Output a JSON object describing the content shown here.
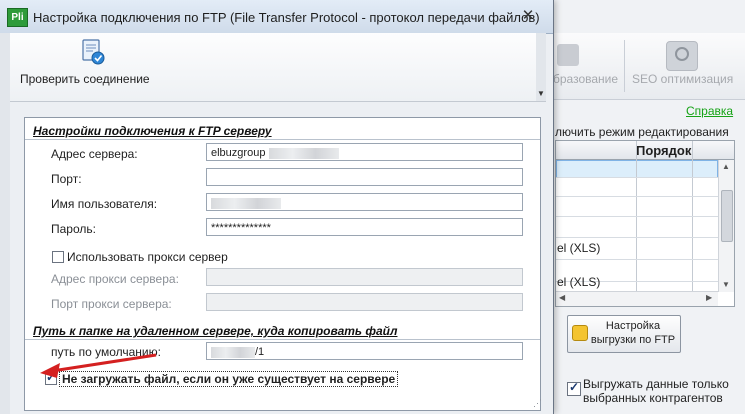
{
  "dialog": {
    "title": "Настройка подключения по FTP (File Transfer Protocol - протокол передачи файлов)",
    "app_icon_text": "Pli",
    "close_glyph": "✕"
  },
  "toolbar": {
    "check_connection_label": "Проверить соединение"
  },
  "connection_section": {
    "heading": "Настройки подключения к FTP серверу",
    "server_address_label": "Адрес сервера:",
    "server_address_value": "elbuzgroup",
    "port_label": "Порт:",
    "port_value": "",
    "username_label": "Имя пользователя:",
    "username_value": "",
    "password_label": "Пароль:",
    "password_value": "**************",
    "use_proxy_label": "Использовать прокси сервер",
    "use_proxy_checked": false,
    "proxy_address_label": "Адрес прокси сервера:",
    "proxy_address_value": "",
    "proxy_port_label": "Порт прокси сервера:",
    "proxy_port_value": ""
  },
  "remote_section": {
    "heading": "Путь к папке на удаленном сервере, куда копировать файл",
    "default_path_label": "путь по умолчанию:",
    "default_path_value_suffix": "/1",
    "skip_existing_label": "Не загружать файл, если он уже существует на сервере",
    "skip_existing_checked": true
  },
  "background": {
    "ribbon_obraz_label": "бразование",
    "ribbon_seo_label": "SEO оптимизация",
    "help_link": "Справка",
    "edit_mode_text": "лючить режим редактирования",
    "grid_order_header": "Порядок",
    "grid_rows": [
      "",
      "",
      "",
      "el (XLS)",
      "",
      "el (XLS)",
      ""
    ],
    "ftp_button_line1": "Настройка",
    "ftp_button_line2": "выгрузки по FTP",
    "export_checkbox_line1": "Выгружать данные только",
    "export_checkbox_line2": "выбранных контрагентов",
    "export_checkbox_checked": true,
    "colors": {
      "help_link": "#16a316",
      "selection": "#dceefb",
      "arrow": "#d42020"
    }
  }
}
